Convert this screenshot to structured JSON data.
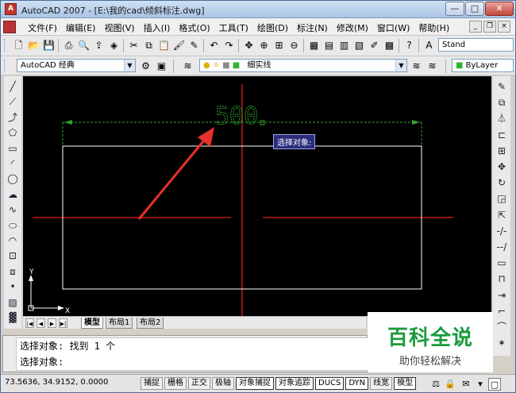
{
  "window": {
    "title": "AutoCAD 2007 - [E:\\我的cad\\倾斜标注.dwg]",
    "icon_letter": "A",
    "minimize_glyph": "—",
    "maximize_glyph": "□",
    "close_glyph": "✕"
  },
  "menubar": {
    "items": [
      "文件(F)",
      "编辑(E)",
      "视图(V)",
      "插入(I)",
      "格式(O)",
      "工具(T)",
      "绘图(D)",
      "标注(N)",
      "修改(M)",
      "窗口(W)",
      "帮助(H)"
    ],
    "doc_controls": [
      "_",
      "❐",
      "×"
    ]
  },
  "toolbar_standard": {
    "icons": [
      "new-icon",
      "open-icon",
      "save-icon",
      "plot-icon",
      "plot-preview-icon",
      "publish-icon",
      "3d-dwf-icon",
      "cut-icon",
      "copy-icon",
      "paste-icon",
      "match-properties-icon",
      "block-editor-icon",
      "undo-icon",
      "redo-icon",
      "pan-icon",
      "zoom-realtime-icon",
      "zoom-window-icon",
      "zoom-previous-icon",
      "properties-icon",
      "design-center-icon",
      "tool-palettes-icon",
      "sheet-set-icon",
      "markup-icon",
      "calculator-icon",
      "help-icon",
      "text-style-icon"
    ],
    "text_style_value": "Stand"
  },
  "toolbar_layers": {
    "workspace_value": "AutoCAD 经典",
    "layer_value": "细实线",
    "color_value": "ByLayer"
  },
  "left_tools": [
    "line-icon",
    "construction-line-icon",
    "polyline-icon",
    "polygon-icon",
    "rectangle-icon",
    "arc-icon",
    "circle-icon",
    "revision-cloud-icon",
    "spline-icon",
    "ellipse-icon",
    "ellipse-arc-icon",
    "insert-block-icon",
    "make-block-icon",
    "point-icon",
    "hatch-icon",
    "gradient-icon"
  ],
  "right_tools": [
    "erase-icon",
    "copy-object-icon",
    "mirror-icon",
    "offset-icon",
    "array-icon",
    "move-icon",
    "rotate-icon",
    "scale-icon",
    "stretch-icon",
    "trim-icon",
    "extend-icon",
    "break-at-point-icon",
    "break-icon",
    "join-icon",
    "chamfer-icon",
    "fillet-icon",
    "explode-icon"
  ],
  "drawing": {
    "dimension_text": "500",
    "tooltip": "选择对象:",
    "ucs_x": "X",
    "ucs_y": "Y",
    "colors": {
      "background": "#000000",
      "rectangle": "#ffffff",
      "centerline": "#e01c1c",
      "dimension": "#2fa52f",
      "arrow": "#e8302a"
    }
  },
  "layout_tabs": {
    "nav": [
      "|◀",
      "◀",
      "▶",
      "▶|"
    ],
    "tabs": [
      "模型",
      "布局1",
      "布局2"
    ],
    "active": "模型"
  },
  "command": {
    "lines": [
      "选择对象: 找到 1 个",
      "选择对象:"
    ]
  },
  "watermark": {
    "title": "百科全说",
    "subtitle": "助你轻松解决"
  },
  "statusbar": {
    "coordinates": "73.5636,  34.9152, 0.0000",
    "toggles": [
      "捕捉",
      "栅格",
      "正交",
      "极轴",
      "对象捕捉",
      "对象追踪",
      "DUCS",
      "DYN",
      "线宽",
      "模型"
    ],
    "toggles_on": [
      "对象捕捉",
      "对象追踪",
      "DUCS",
      "DYN",
      "模型"
    ]
  }
}
